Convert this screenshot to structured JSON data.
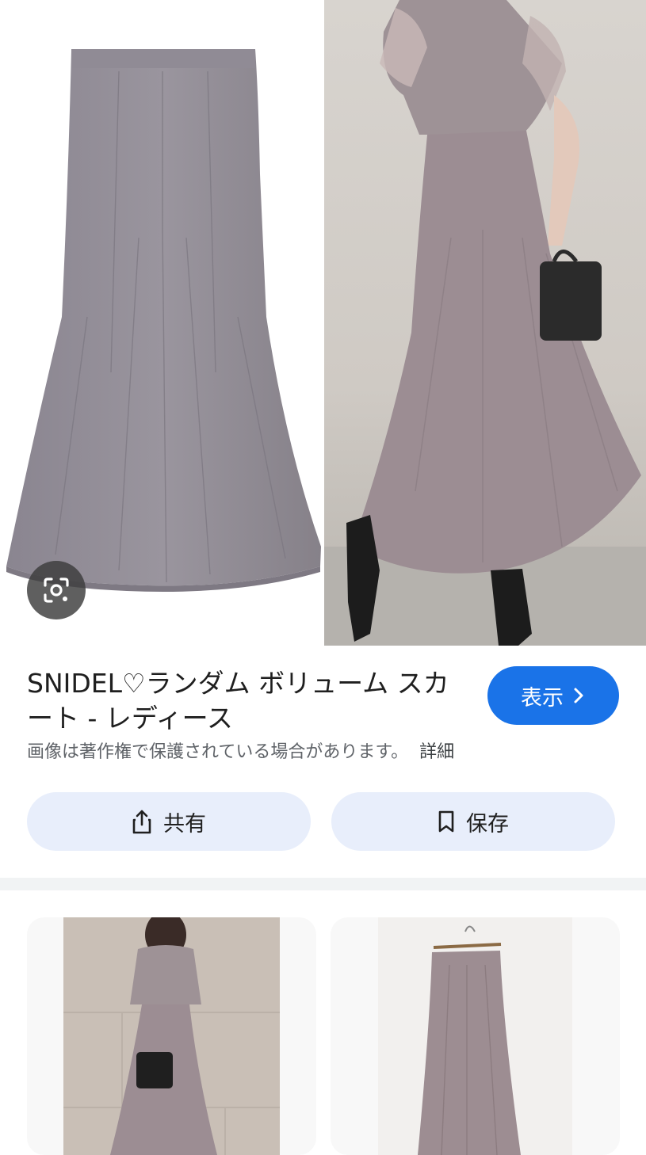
{
  "result": {
    "title": "SNIDEL♡ランダム ボリューム スカート - レディース",
    "visit_label": "表示",
    "copyright_notice": "画像は著作権で保護されている場合があります。",
    "details_link": "詳細",
    "share_label": "共有",
    "save_label": "保存"
  },
  "icons": {
    "lens": "google-lens-icon",
    "chevron": "chevron-right-icon",
    "share": "share-icon",
    "bookmark": "bookmark-icon"
  },
  "colors": {
    "accent": "#1a73e8",
    "action_bg": "#e8eefb",
    "skirt": "#8f8a92",
    "model_skirt": "#9c8d93"
  }
}
